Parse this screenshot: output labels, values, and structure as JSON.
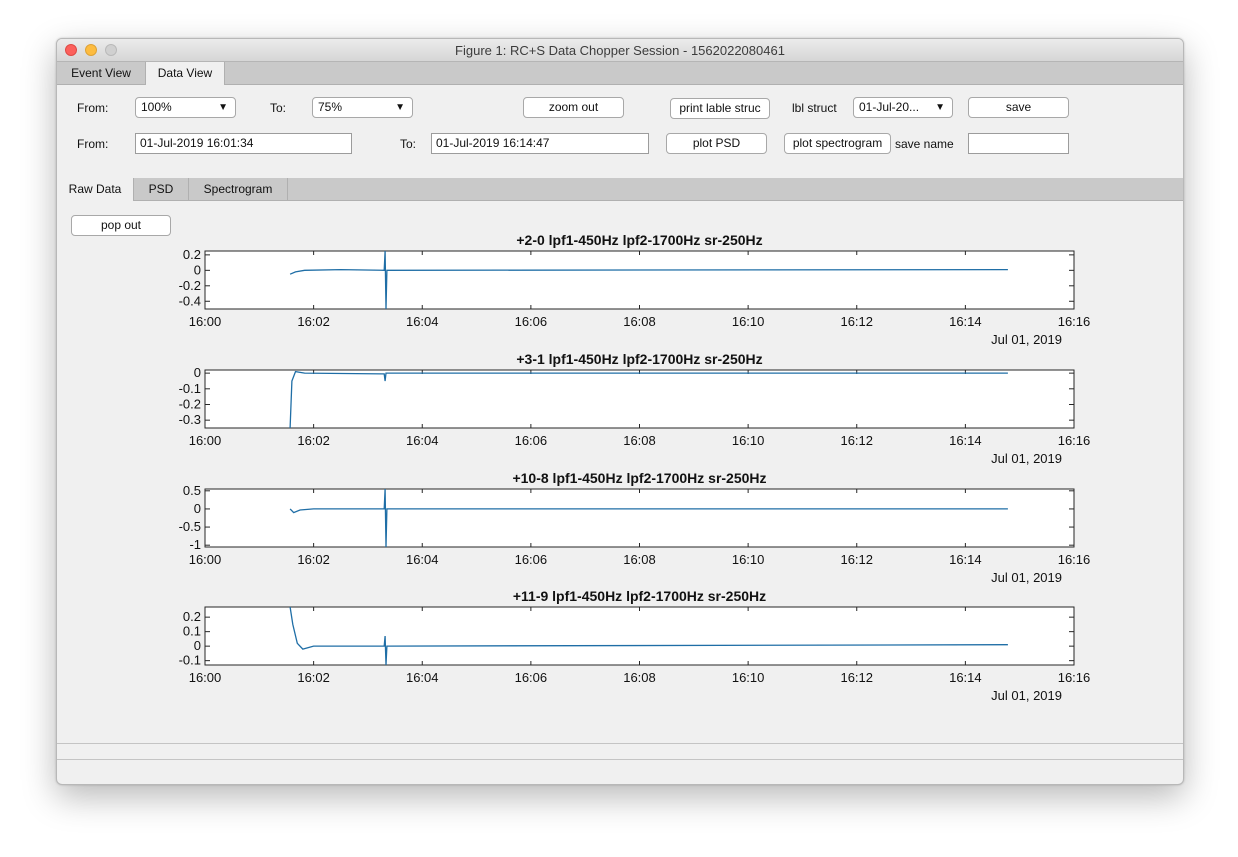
{
  "window": {
    "title": "Figure 1: RC+S Data Chopper Session - 1562022080461"
  },
  "top_tabs": [
    {
      "label": "Event View"
    },
    {
      "label": "Data View"
    }
  ],
  "controls": {
    "from_pct_label": "From:",
    "from_pct_value": "100%",
    "to_pct_label": "To:",
    "to_pct_value": "75%",
    "zoom_out": "zoom out",
    "print_lable_struc": "print lable struc",
    "lbl_struct_label": "lbl struct",
    "lbl_struct_value": "01-Jul-20...",
    "save": "save",
    "from_time_label": "From:",
    "from_time_value": "01-Jul-2019 16:01:34",
    "to_time_label": "To:",
    "to_time_value": "01-Jul-2019 16:14:47",
    "plot_psd": "plot PSD",
    "plot_spectrogram": "plot spectrogram",
    "save_name_label": "save name",
    "save_name_value": ""
  },
  "inner_tabs": [
    {
      "label": "Raw Data"
    },
    {
      "label": "PSD"
    },
    {
      "label": "Spectrogram"
    }
  ],
  "pop_out": "pop out",
  "chart_data": [
    {
      "type": "line",
      "title": "+2-0 lpf1-450Hz lpf2-1700Hz sr-250Hz",
      "x_ticks": [
        "16:00",
        "16:02",
        "16:04",
        "16:06",
        "16:08",
        "16:10",
        "16:12",
        "16:14",
        "16:16"
      ],
      "x_date_label": "Jul 01, 2019",
      "xlim": [
        "16:00",
        "16:16"
      ],
      "ylim": [
        -0.5,
        0.25
      ],
      "y_ticks": [
        "0.2",
        "0",
        "-0.2",
        "-0.4"
      ],
      "y_tick_values": [
        0.2,
        0,
        -0.2,
        -0.4
      ],
      "color": "#1f6ea6",
      "series": [
        {
          "points": [
            [
              "16:01:34",
              -0.05
            ],
            [
              "16:01:40",
              -0.02
            ],
            [
              "16:01:50",
              0.0
            ],
            [
              "16:02:30",
              0.01
            ],
            [
              "16:03:18",
              0.0
            ],
            [
              "16:03:19",
              0.25
            ],
            [
              "16:03:20",
              -0.5
            ],
            [
              "16:03:21",
              0.0
            ],
            [
              "16:14:47",
              0.01
            ]
          ]
        }
      ]
    },
    {
      "type": "line",
      "title": "+3-1 lpf1-450Hz lpf2-1700Hz sr-250Hz",
      "x_ticks": [
        "16:00",
        "16:02",
        "16:04",
        "16:06",
        "16:08",
        "16:10",
        "16:12",
        "16:14",
        "16:16"
      ],
      "x_date_label": "Jul 01, 2019",
      "xlim": [
        "16:00",
        "16:16"
      ],
      "ylim": [
        -0.35,
        0.02
      ],
      "y_ticks": [
        "0",
        "-0.1",
        "-0.2",
        "-0.3"
      ],
      "y_tick_values": [
        0,
        -0.1,
        -0.2,
        -0.3
      ],
      "color": "#1f6ea6",
      "series": [
        {
          "points": [
            [
              "16:01:34",
              -0.35
            ],
            [
              "16:01:36",
              -0.05
            ],
            [
              "16:01:40",
              0.01
            ],
            [
              "16:01:50",
              0.0
            ],
            [
              "16:03:18",
              -0.005
            ],
            [
              "16:03:19",
              -0.05
            ],
            [
              "16:03:20",
              0.0
            ],
            [
              "16:14:47",
              0.0
            ]
          ]
        }
      ]
    },
    {
      "type": "line",
      "title": "+10-8 lpf1-450Hz lpf2-1700Hz sr-250Hz",
      "x_ticks": [
        "16:00",
        "16:02",
        "16:04",
        "16:06",
        "16:08",
        "16:10",
        "16:12",
        "16:14",
        "16:16"
      ],
      "x_date_label": "Jul 01, 2019",
      "xlim": [
        "16:00",
        "16:16"
      ],
      "ylim": [
        -1.05,
        0.55
      ],
      "y_ticks": [
        "0.5",
        "0",
        "-0.5",
        "-1"
      ],
      "y_tick_values": [
        0.5,
        0,
        -0.5,
        -1
      ],
      "color": "#1f6ea6",
      "series": [
        {
          "points": [
            [
              "16:01:34",
              0.0
            ],
            [
              "16:01:38",
              -0.1
            ],
            [
              "16:01:45",
              -0.03
            ],
            [
              "16:02:00",
              0.0
            ],
            [
              "16:03:18",
              0.0
            ],
            [
              "16:03:19",
              0.55
            ],
            [
              "16:03:20",
              -1.05
            ],
            [
              "16:03:21",
              0.0
            ],
            [
              "16:14:47",
              0.0
            ]
          ]
        }
      ]
    },
    {
      "type": "line",
      "title": "+11-9 lpf1-450Hz lpf2-1700Hz sr-250Hz",
      "x_ticks": [
        "16:00",
        "16:02",
        "16:04",
        "16:06",
        "16:08",
        "16:10",
        "16:12",
        "16:14",
        "16:16"
      ],
      "x_date_label": "Jul 01, 2019",
      "xlim": [
        "16:00",
        "16:16"
      ],
      "ylim": [
        -0.13,
        0.27
      ],
      "y_ticks": [
        "0.2",
        "0.1",
        "0",
        "-0.1"
      ],
      "y_tick_values": [
        0.2,
        0.1,
        0,
        -0.1
      ],
      "color": "#1f6ea6",
      "series": [
        {
          "points": [
            [
              "16:01:34",
              0.27
            ],
            [
              "16:01:37",
              0.15
            ],
            [
              "16:01:42",
              0.02
            ],
            [
              "16:01:48",
              -0.02
            ],
            [
              "16:02:00",
              0.0
            ],
            [
              "16:03:18",
              0.0
            ],
            [
              "16:03:19",
              0.07
            ],
            [
              "16:03:20",
              -0.13
            ],
            [
              "16:03:21",
              0.0
            ],
            [
              "16:14:47",
              0.01
            ]
          ]
        }
      ]
    }
  ]
}
